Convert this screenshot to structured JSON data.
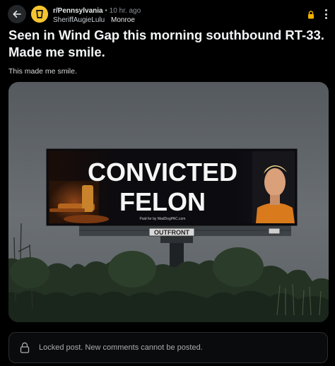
{
  "post": {
    "subreddit": "r/Pennsylvania",
    "separator": "•",
    "time_ago": "10 hr. ago",
    "author": "SheriffAugieLulu",
    "author_flair": "Monroe",
    "title": "Seen in Wind Gap this morning southbound RT-33. Made me smile.",
    "body": "This made me smile."
  },
  "billboard": {
    "headline_line1": "CONVICTED",
    "headline_line2": "FELON",
    "paid_for": "Paid for by MadDogPAC.com",
    "brand": "OUTFRONT"
  },
  "footer": {
    "locked_message": "Locked post. New comments cannot be posted."
  },
  "icons": {
    "back": "arrow-left-icon",
    "lock": "lock-icon",
    "more": "more-vertical-icon",
    "avatar": "subreddit-avatar"
  },
  "colors": {
    "background": "#000000",
    "lock_accent": "#f2b200",
    "avatar": "#f4c430"
  }
}
